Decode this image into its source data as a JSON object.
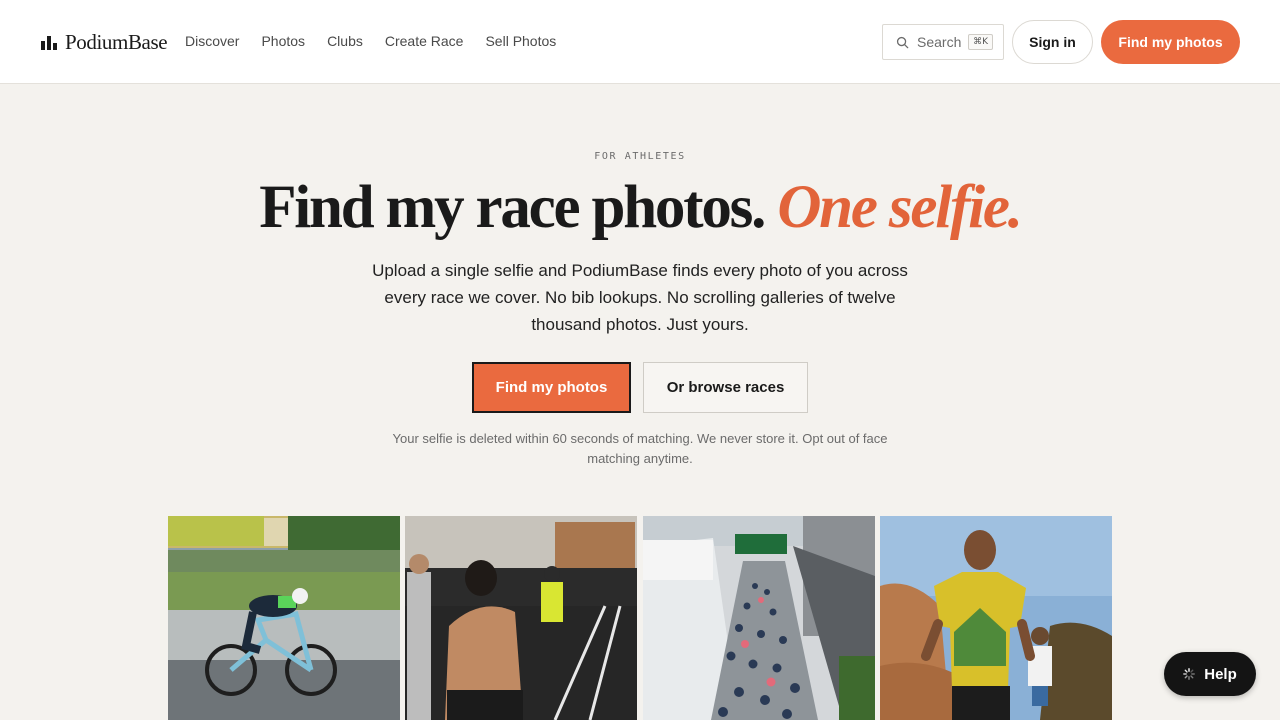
{
  "header": {
    "logo_text": "PodiumBase",
    "nav": [
      "Discover",
      "Photos",
      "Clubs",
      "Create Race",
      "Sell Photos"
    ],
    "search": {
      "label": "Search",
      "shortcut": "⌘K"
    },
    "signin_label": "Sign in",
    "cta_label": "Find my photos"
  },
  "hero": {
    "eyebrow": "FOR ATHLETES",
    "headline": "Find my race photos.",
    "headline_accent": "One selfie.",
    "subtext": "Upload a single selfie and PodiumBase finds every photo of you across every race we cover. No bib lookups. No scrolling galleries of twelve thousand photos. Just yours.",
    "primary_cta": "Find my photos",
    "secondary_cta": "Or browse races",
    "privacy_note": "Your selfie is deleted within 60 seconds of matching. We never store it. Opt out of face matching anytime."
  },
  "photos": [
    {
      "icon": "cyclist-photo",
      "caption": ""
    },
    {
      "icon": "gym-athlete-photo",
      "caption": ""
    },
    {
      "icon": "marathon-crowd-photo",
      "caption": ""
    },
    {
      "icon": "trail-runner-photo",
      "caption": ""
    }
  ],
  "help": {
    "label": "Help"
  },
  "colors": {
    "accent": "#ea6a3f",
    "headline_accent": "#e2643a",
    "background": "#f4f2ee",
    "dark": "#141414"
  }
}
